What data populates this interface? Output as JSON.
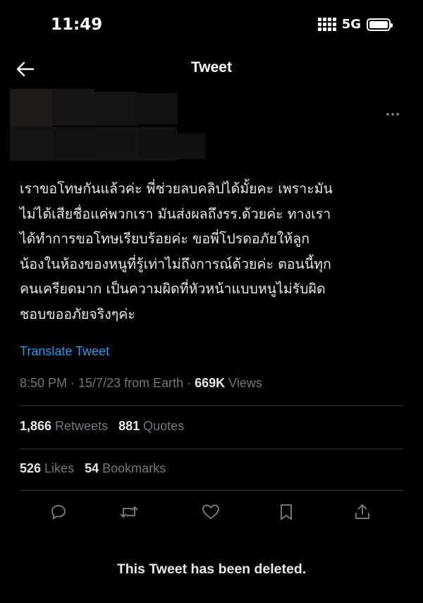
{
  "status_bar": {
    "time": "11:49",
    "network": "5G",
    "icons": [
      "signal-icon",
      "battery-icon"
    ]
  },
  "header": {
    "title": "Tweet",
    "back_icon": "arrow-left-icon"
  },
  "tweet": {
    "text_lines": [
      "เราขอโทษกันแล้วค่ะ พี่ช่วยลบคลิปได้มั้ยคะ เพราะมัน",
      "ไม่ได้เสียชื่อแค่พวกเรา มันส่งผลถึงรร.ด้วยค่ะ ทางเรา",
      "ได้ทำการขอโทษเรียบร้อยค่ะ ขอพี่โปรดอภัยให้ลูก",
      "น้องในห้องของหนูที่รู้เท่าไม่ถึงการณ์ด้วยค่ะ ตอนนี้ทุก",
      "คนเครียดมาก เป็นความผิดที่หัวหน้าแบบหนูไม่รับผิด",
      "ชอบขออภัยจริงๆค่ะ"
    ],
    "translate_label": "Translate Tweet",
    "timestamp": "8:50 PM · 15/7/23 from Earth · ",
    "views_count": "669K",
    "views_label": " Views"
  },
  "stats": {
    "retweets_count": "1,866",
    "retweets_label": " Retweets",
    "quotes_count": "881",
    "quotes_label": " Quotes",
    "likes_count": "526",
    "likes_label": " Likes",
    "bookmarks_count": "54",
    "bookmarks_label": " Bookmarks"
  },
  "actions": [
    "reply-icon",
    "retweet-icon",
    "like-icon",
    "bookmark-icon",
    "share-icon"
  ],
  "deleted_notice": "This Tweet has been deleted.",
  "colors": {
    "background": "#000000",
    "text": "#e7e9ea",
    "secondary": "#71767b",
    "link": "#1d9bf0",
    "divider": "#2f3336"
  }
}
